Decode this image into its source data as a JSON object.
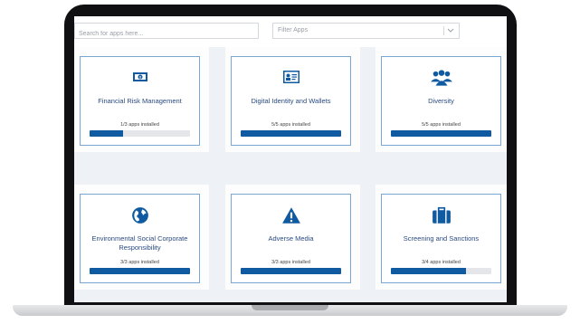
{
  "search": {
    "placeholder": "Search for apps here..."
  },
  "filter": {
    "label": "Filter Apps"
  },
  "colors": {
    "accent": "#0f5aa0",
    "card_border": "#7aa6d4",
    "title": "#2a4a82"
  },
  "cards": [
    {
      "title": "Financial Risk Management",
      "count": "1/3 apps installed",
      "progress": 0.33,
      "icon": "money-icon"
    },
    {
      "title": "Digital Identity and Wallets",
      "count": "5/5 apps installed",
      "progress": 1.0,
      "icon": "id-card-icon"
    },
    {
      "title": "Diversity",
      "count": "5/5 apps installed",
      "progress": 1.0,
      "icon": "people-group-icon"
    },
    {
      "title": "Environmental Social Corporate Responsibility",
      "count": "3/3 apps installed",
      "progress": 1.0,
      "icon": "globe-icon"
    },
    {
      "title": "Adverse Media",
      "count": "3/3 apps installed",
      "progress": 1.0,
      "icon": "warning-icon"
    },
    {
      "title": "Screening and Sanctions",
      "count": "3/4 apps installed",
      "progress": 0.75,
      "icon": "briefcase-icon"
    }
  ]
}
